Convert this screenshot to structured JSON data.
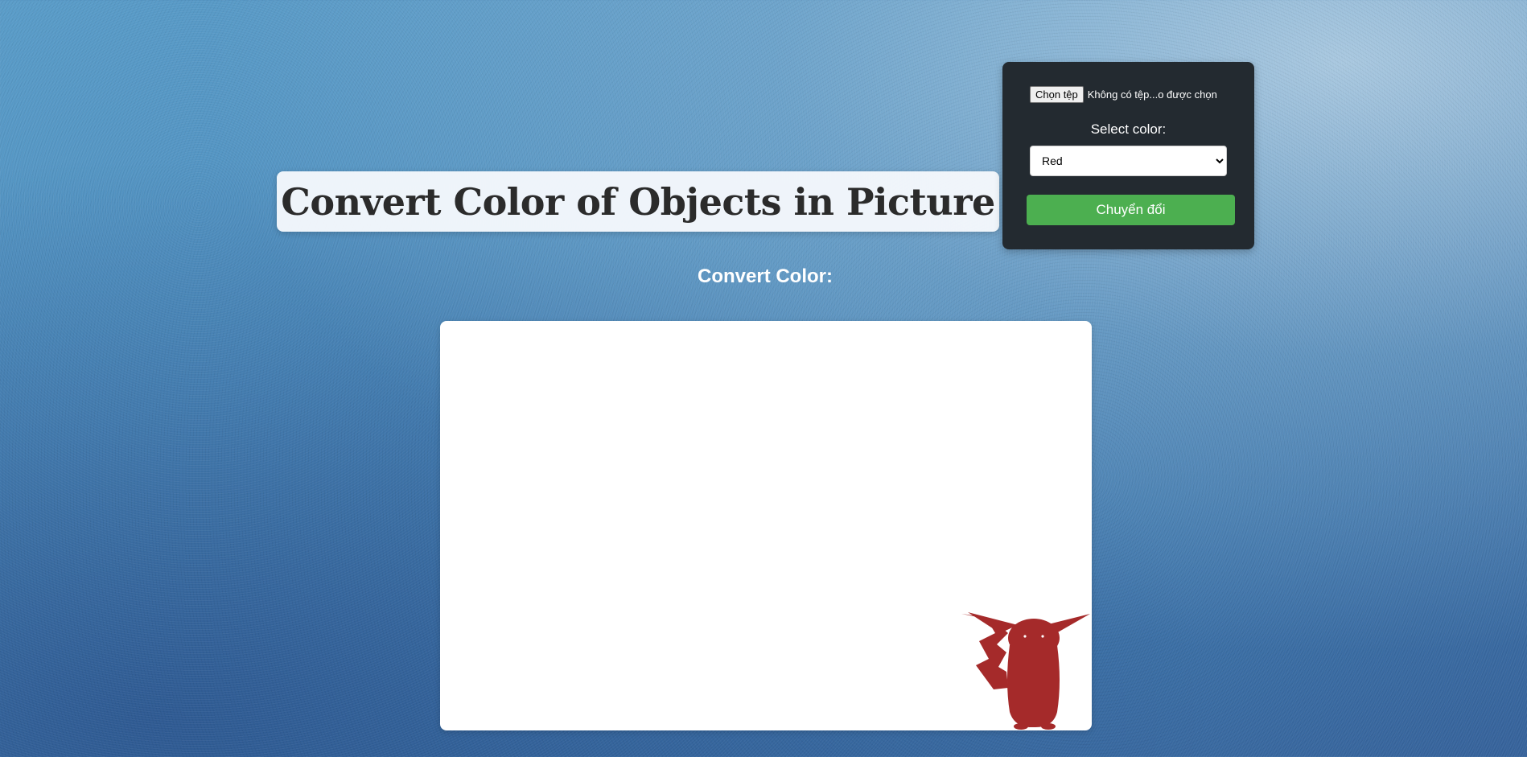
{
  "header": {
    "title": "Convert Color of Objects in Picture"
  },
  "controls": {
    "file_button_label": "Chọn tệp",
    "file_status": "Không có tệp...o được chọn",
    "select_label": "Select color:",
    "selected_color": "Red",
    "color_options": [
      "Red"
    ],
    "convert_button_label": "Chuyển đổi"
  },
  "result": {
    "heading": "Convert Color:",
    "object_color": "#a52a2a",
    "image_icon": "pikachu-silhouette"
  },
  "colors": {
    "panel_bg": "#232a30",
    "convert_button": "#4caf50",
    "title_box_bg": "#f5f8fc"
  }
}
